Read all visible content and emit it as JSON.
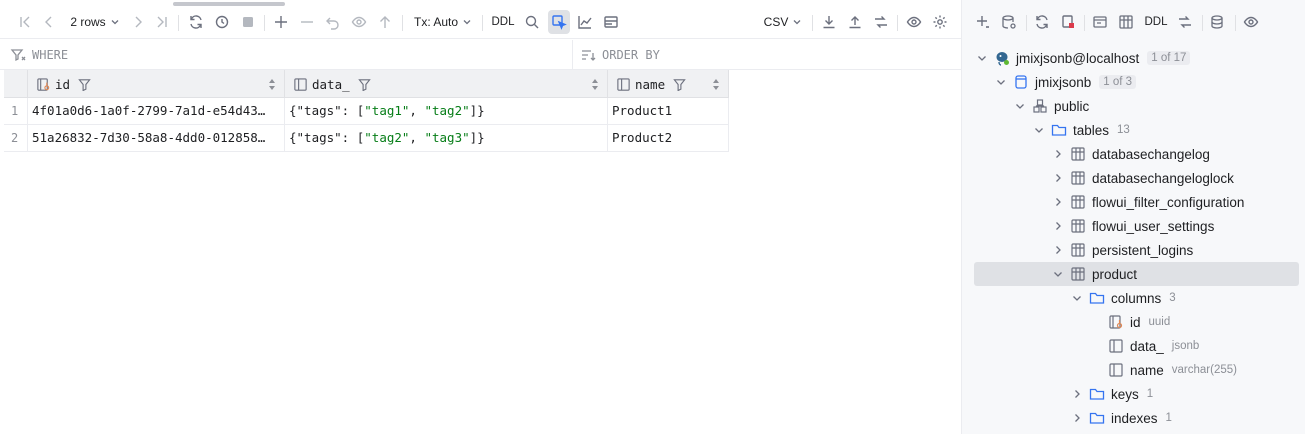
{
  "toolbar": {
    "rows_label": "2 rows",
    "tx_label": "Tx: Auto",
    "ddl_label": "DDL",
    "export_format": "CSV"
  },
  "filter": {
    "where_placeholder": "WHERE",
    "orderby_placeholder": "ORDER BY"
  },
  "grid": {
    "columns": [
      "id",
      "data_",
      "name"
    ],
    "rows": [
      {
        "num": "1",
        "id": "4f01a0d6-1a0f-2799-7a1d-e54d43…",
        "data_prefix": "{\"tags\": [",
        "tag_a": "\"tag1\"",
        "sep": ", ",
        "tag_b": "\"tag2\"",
        "data_suffix": "]}",
        "name": "Product1"
      },
      {
        "num": "2",
        "id": "51a26832-7d30-58a8-4dd0-012858…",
        "data_prefix": "{\"tags\": [",
        "tag_a": "\"tag2\"",
        "sep": ", ",
        "tag_b": "\"tag3\"",
        "data_suffix": "]}",
        "name": "Product2"
      }
    ]
  },
  "right_toolbar": {
    "ddl_label": "DDL"
  },
  "tree": {
    "datasource": {
      "label": "jmixjsonb@localhost",
      "badge": "1 of 17"
    },
    "database": {
      "label": "jmixjsonb",
      "badge": "1 of 3"
    },
    "schema": {
      "label": "public"
    },
    "tables": {
      "label": "tables",
      "count": "13"
    },
    "table_items": [
      "databasechangelog",
      "databasechangeloglock",
      "flowui_filter_configuration",
      "flowui_user_settings",
      "persistent_logins",
      "product"
    ],
    "columns_folder": {
      "label": "columns",
      "count": "3"
    },
    "column_items": [
      {
        "name": "id",
        "type": "uuid"
      },
      {
        "name": "data_",
        "type": "jsonb"
      },
      {
        "name": "name",
        "type": "varchar(255)"
      }
    ],
    "keys": {
      "label": "keys",
      "count": "1"
    },
    "indexes": {
      "label": "indexes",
      "count": "1"
    }
  },
  "colors": {
    "json_string": "#067d17",
    "selection": "#dfe1e5",
    "folder_blue": "#3574f0"
  }
}
